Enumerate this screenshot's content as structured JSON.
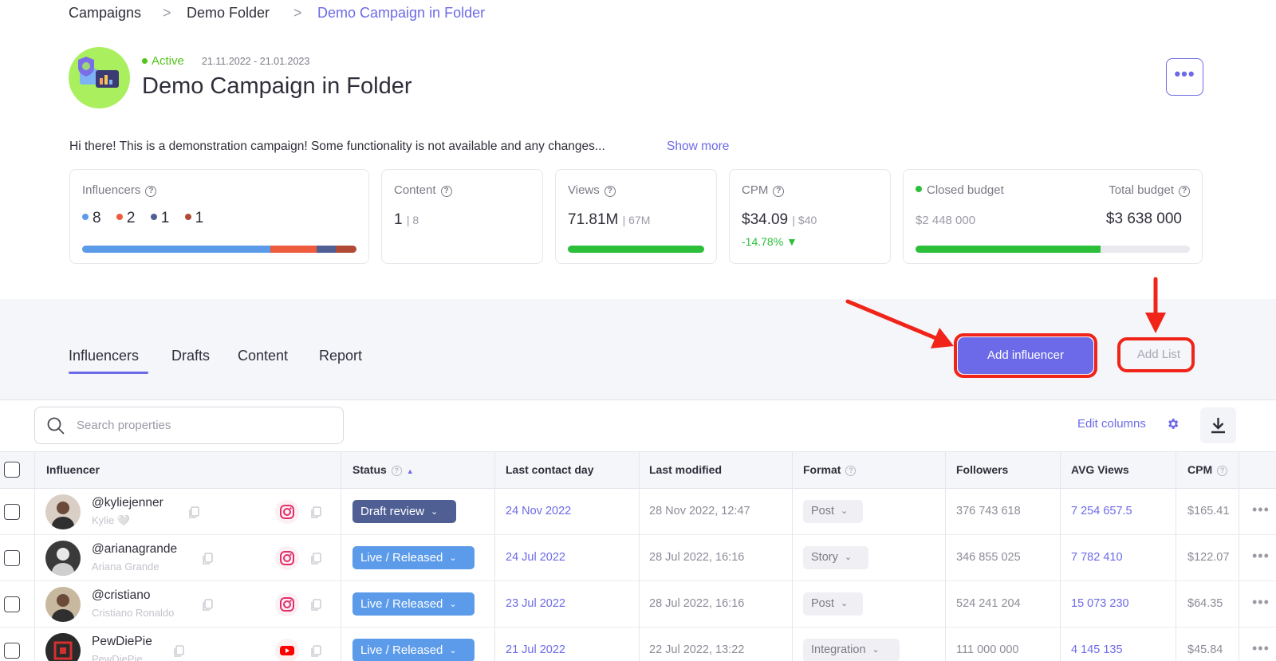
{
  "breadcrumb": {
    "items": [
      "Campaigns",
      "Demo Folder",
      "Demo Campaign in Folder"
    ],
    "separator": ">"
  },
  "campaign": {
    "status": "Active",
    "date_range": "21.11.2022 - 21.01.2023",
    "title": "Demo Campaign in Folder",
    "description": "Hi there! This is a demonstration campaign! Some functionality is not available and any changes...",
    "show_more": "Show more",
    "more_button": "•••"
  },
  "stats": {
    "influencers": {
      "label": "Influencers",
      "counts": [
        {
          "value": "8",
          "color": "#5b9bea"
        },
        {
          "value": "2",
          "color": "#ee5a3c"
        },
        {
          "value": "1",
          "color": "#4f5f94"
        },
        {
          "value": "1",
          "color": "#b04a35"
        }
      ]
    },
    "content": {
      "label": "Content",
      "value": "1",
      "total": "| 8"
    },
    "views": {
      "label": "Views",
      "value": "71.81M",
      "target": "| 67M",
      "progress": 1.0
    },
    "cpm": {
      "label": "CPM",
      "value": "$34.09",
      "target": "| $40",
      "change": "-14.78%",
      "change_arrow": "▼"
    },
    "budget": {
      "closed_label": "Closed budget",
      "closed_value": "$2 448 000",
      "total_label": "Total budget",
      "total_value": "$3 638 000",
      "progress": 0.673
    }
  },
  "tabs": [
    "Influencers",
    "Drafts",
    "Content",
    "Report"
  ],
  "actions": {
    "add_influencer": "Add influencer",
    "add_list": "Add List"
  },
  "toolbar": {
    "search_placeholder": "Search properties",
    "edit_columns": "Edit columns"
  },
  "table": {
    "columns": [
      "Influencer",
      "Status",
      "Last contact day",
      "Last modified",
      "Format",
      "Followers",
      "AVG Views",
      "CPM"
    ],
    "rows": [
      {
        "handle": "@kyliejenner",
        "name": "Kylie 🤍",
        "platform": "instagram",
        "status": "Draft review",
        "status_color": "#4f5f94",
        "last_contact": "24 Nov 2022",
        "modified": "28 Nov 2022, 12:47",
        "format": "Post",
        "followers": "376 743 618",
        "avg_views": "7 254 657.5",
        "cpm": "$165.41"
      },
      {
        "handle": "@arianagrande",
        "name": "Ariana Grande",
        "platform": "instagram",
        "status": "Live / Released",
        "status_color": "#5b9bea",
        "last_contact": "24 Jul 2022",
        "modified": "28 Jul 2022, 16:16",
        "format": "Story",
        "followers": "346 855 025",
        "avg_views": "7 782 410",
        "cpm": "$122.07"
      },
      {
        "handle": "@cristiano",
        "name": "Cristiano Ronaldo",
        "platform": "instagram",
        "status": "Live / Released",
        "status_color": "#5b9bea",
        "last_contact": "23 Jul 2022",
        "modified": "28 Jul 2022, 16:16",
        "format": "Post",
        "followers": "524 241 204",
        "avg_views": "15 073 230",
        "cpm": "$64.35"
      },
      {
        "handle": "PewDiePie",
        "name": "PewDiePie",
        "platform": "youtube",
        "status": "Live / Released",
        "status_color": "#5b9bea",
        "last_contact": "21 Jul 2022",
        "modified": "22 Jul 2022, 13:22",
        "format": "Integration",
        "followers": "111 000 000",
        "avg_views": "4 145 135",
        "cpm": "$45.84"
      }
    ],
    "row_more": "•••"
  },
  "colors": {
    "accent": "#6c6ae8",
    "success": "#52c41a",
    "annotation_red": "#f02418"
  }
}
